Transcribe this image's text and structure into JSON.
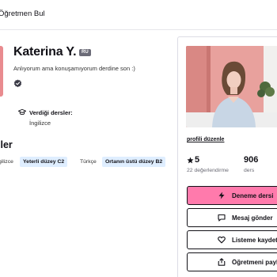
{
  "nav": {
    "find_tutor_label": "Öğretmen Bul"
  },
  "profile": {
    "name": "Katerina Y.",
    "country_code": "RU",
    "tagline": "Anlıyorum ama konuşamıyorum derdine son :)",
    "teaches": {
      "title": "Verdiği dersler:",
      "value": "İngilizce"
    }
  },
  "skills": {
    "title": "ller",
    "items": [
      {
        "language": "gilizce",
        "level": "Yeterli düzey C2"
      },
      {
        "language": "Türkçe",
        "level": "Ortanın üstü düzey B2"
      }
    ]
  },
  "card": {
    "profile_edit_label": "profili düzenle",
    "rating": {
      "value": "5",
      "label": "22 değerlendirme"
    },
    "lessons": {
      "value": "906",
      "label": "ders"
    },
    "buttons": {
      "trial": "Deneme dersi",
      "message": "Mesaj gönder",
      "save": "Listeme kaydet",
      "share": "Öğretmeni paylaş"
    }
  },
  "colors": {
    "primary_button": "#ff7aac",
    "level_pill": "#dfeeff",
    "badge": "#6b6b77"
  }
}
